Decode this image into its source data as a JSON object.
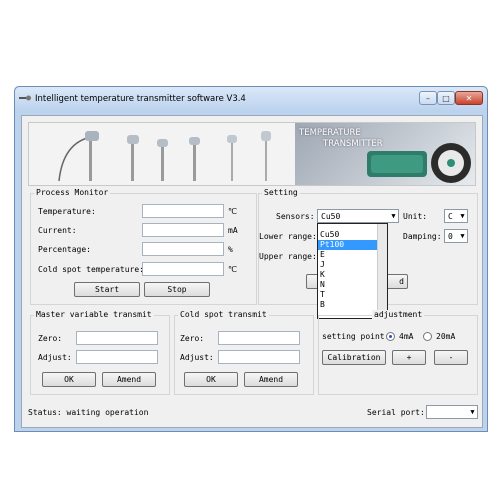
{
  "window": {
    "title": "Intelligent temperature transmitter software V3.4",
    "controls": {
      "minimize": "–",
      "maximize": "□",
      "close": "✕"
    }
  },
  "banner": {
    "title_line1": "TEMPERATURE",
    "title_line2": "TRANSMITTER"
  },
  "process_monitor": {
    "title": "Process Monitor",
    "temperature_label": "Temperature:",
    "temperature_unit": "℃",
    "current_label": "Current:",
    "current_unit": "mA",
    "percentage_label": "Percentage:",
    "percentage_unit": "%",
    "cold_spot_label": "Cold spot temperature:",
    "cold_spot_unit": "℃",
    "start_label": "Start",
    "stop_label": "Stop"
  },
  "setting": {
    "title": "Setting",
    "sensors_label": "Sensors:",
    "sensors_value": "Cu50",
    "unit_label": "Unit:",
    "unit_value": "C",
    "lower_range_label": "Lower range:",
    "damping_label": "Damping:",
    "damping_value": "0",
    "upper_range_label": "Upper range:",
    "hidden_button_tail": "d",
    "sensor_options": [
      "Cu50",
      "Pt100",
      "E",
      "J",
      "K",
      "N",
      "T",
      "B"
    ],
    "selected_index": 1
  },
  "master_transmit": {
    "title": "Master variable transmit",
    "zero_label": "Zero:",
    "adjust_label": "Adjust:",
    "ok_label": "OK",
    "amend_label": "Amend"
  },
  "cold_spot_transmit": {
    "title": "Cold spot transmit",
    "zero_label": "Zero:",
    "adjust_label": "Adjust:",
    "ok_label": "OK",
    "amend_label": "Amend"
  },
  "output_adjustment": {
    "title_fragment": "adjustment",
    "setting_point_label": "setting point:",
    "option_4ma": "4mA",
    "option_20ma": "20mA",
    "selected": "4mA",
    "calibration_label": "Calibration",
    "plus_label": "+",
    "minus_label": "-"
  },
  "status_bar": {
    "status_text": "Status: waiting operation",
    "serial_port_label": "Serial port:",
    "serial_port_value": ""
  },
  "colors": {
    "frame": "#bcd3ee",
    "client": "#f0f0f0",
    "selection": "#3399ff",
    "close": "#c8442e"
  }
}
